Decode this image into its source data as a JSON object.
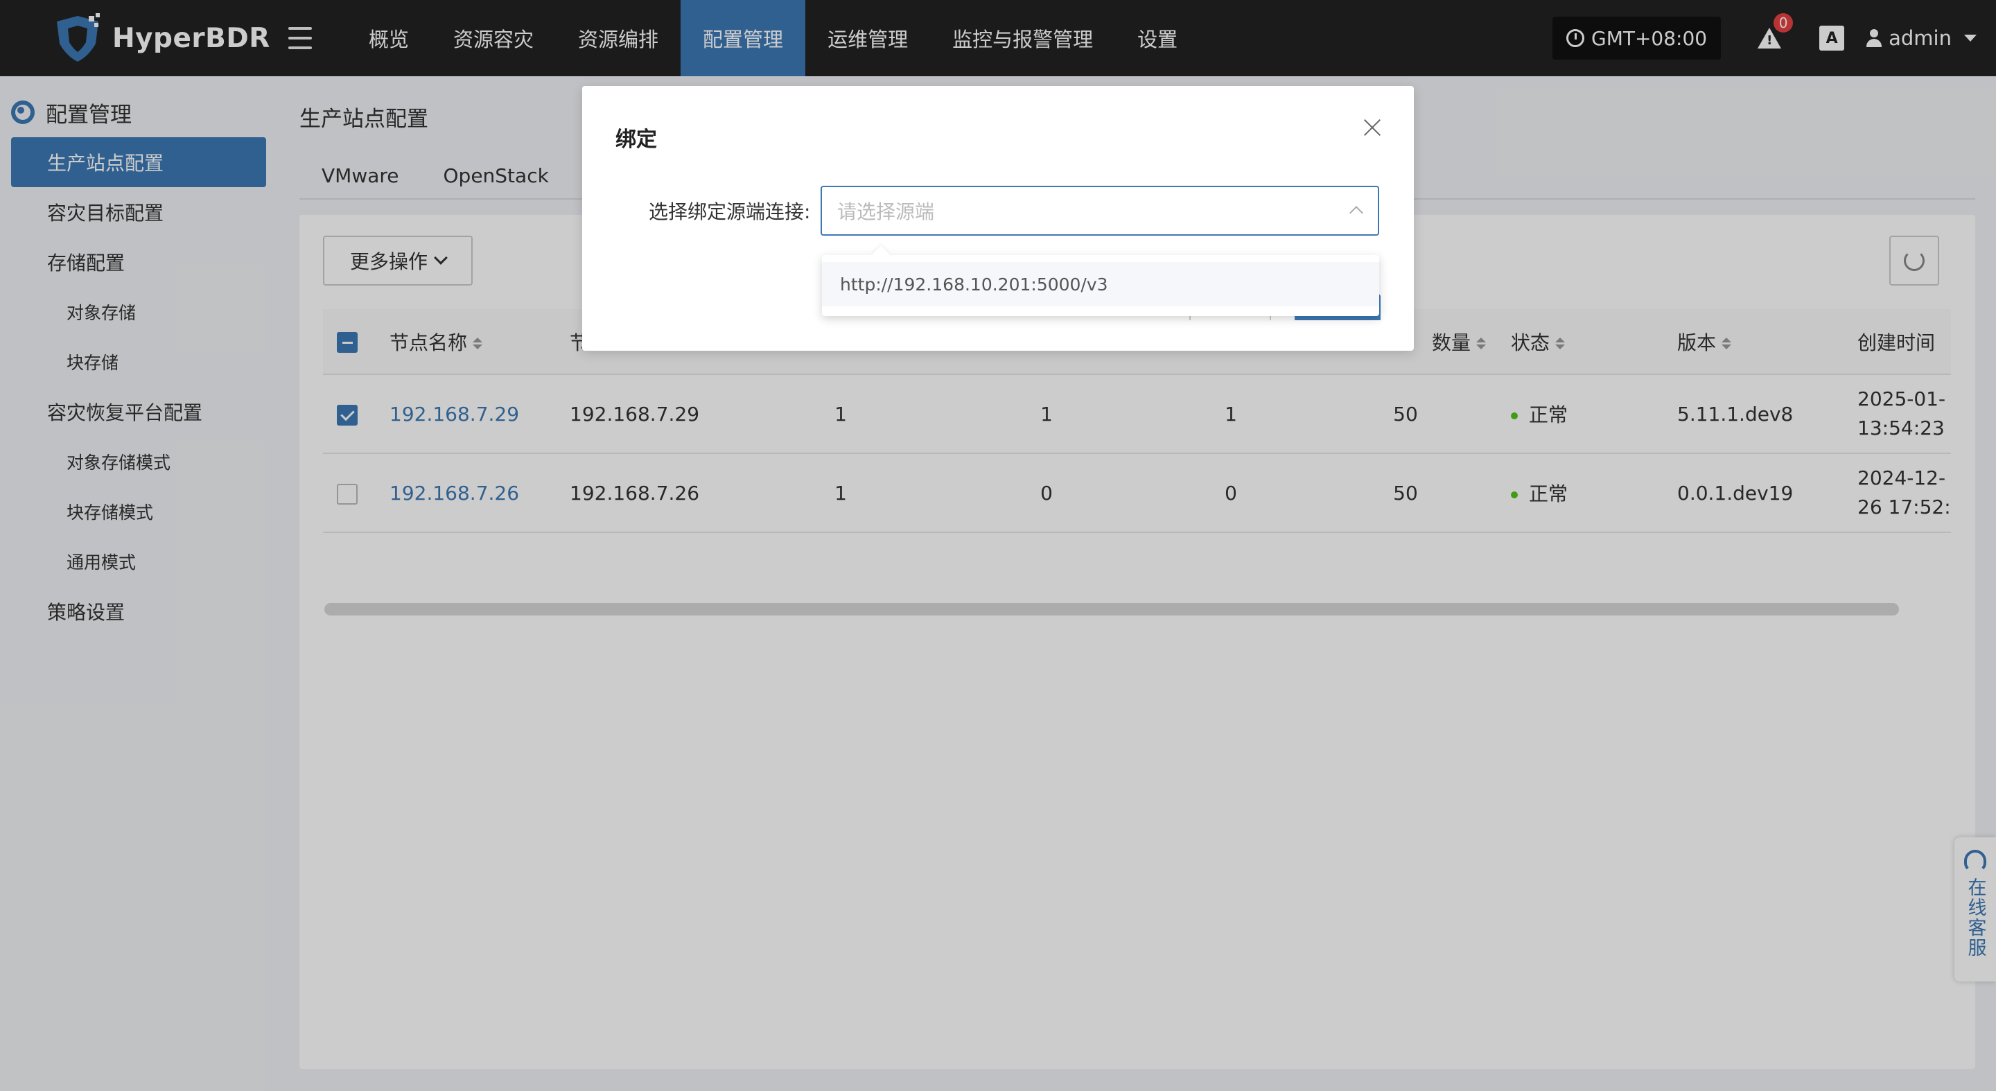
{
  "brand": {
    "name": "HyperBDR"
  },
  "nav": [
    "概览",
    "资源容灾",
    "资源编排",
    "配置管理",
    "运维管理",
    "监控与报警管理",
    "设置"
  ],
  "header": {
    "timezone": "GMT+08:00",
    "alarm_count": "0",
    "lang_icon": "A",
    "user": "admin"
  },
  "sidebar": {
    "title": "配置管理",
    "items": [
      "生产站点配置",
      "容灾目标配置",
      "存储配置",
      "对象存储",
      "块存储",
      "容灾恢复平台配置",
      "对象存储模式",
      "块存储模式",
      "通用模式",
      "策略设置"
    ]
  },
  "page": {
    "title": "生产站点配置",
    "tabs": [
      "VMware",
      "OpenStack"
    ],
    "more_actions": "更多操作"
  },
  "table": {
    "columns": [
      "节点名称",
      "节",
      "",
      "",
      "",
      "数量",
      "状态",
      "版本",
      "创建时间"
    ],
    "rows": [
      {
        "name": "192.168.7.29",
        "ip": "192.168.7.29",
        "c3": "1",
        "c4": "1",
        "c5": "1",
        "count": "50",
        "status": "正常",
        "version": "5.11.1.dev8",
        "created_1": "2025-01-",
        "created_2": "13:54:23",
        "checked": true
      },
      {
        "name": "192.168.7.26",
        "ip": "192.168.7.26",
        "c3": "1",
        "c4": "0",
        "c5": "0",
        "count": "50",
        "status": "正常",
        "version": "0.0.1.dev19",
        "created_1": "2024-12-",
        "created_2": "26 17:52:",
        "checked": false
      }
    ]
  },
  "service": {
    "label": "在线客服"
  },
  "modal": {
    "title": "绑定",
    "label": "选择绑定源端连接:",
    "placeholder": "请选择源端",
    "options": [
      "http://192.168.10.201:5000/v3"
    ]
  },
  "colors": {
    "primary": "#3d78b5",
    "topbar": "#222222",
    "success": "#52c41a",
    "danger": "#e64242"
  }
}
